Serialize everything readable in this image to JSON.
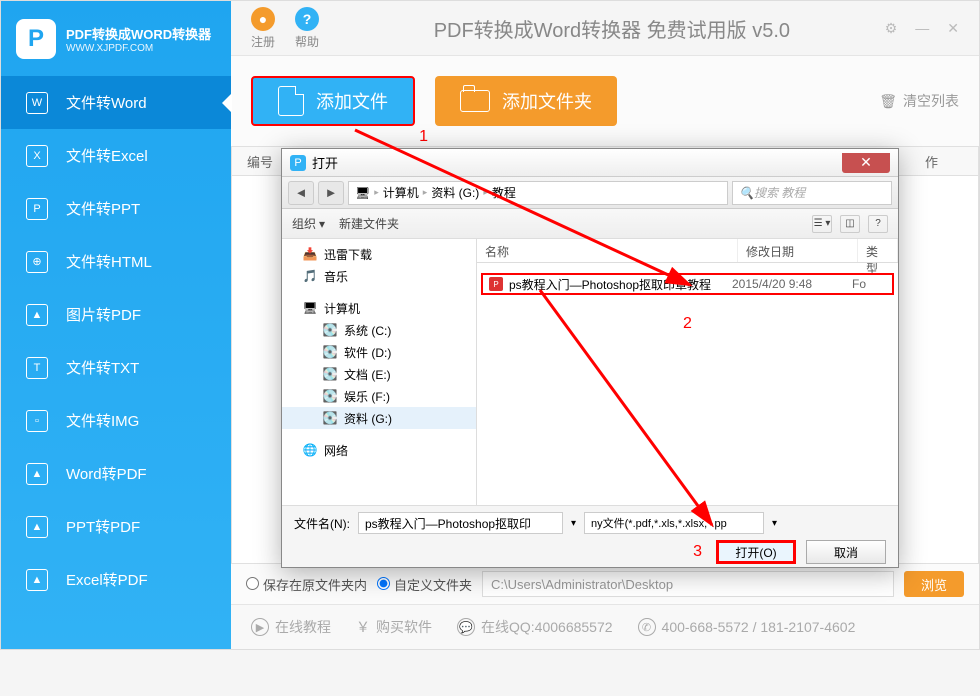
{
  "logo": {
    "title": "PDF转换成WORD转换器",
    "url": "WWW.XJPDF.COM"
  },
  "header": {
    "register": "注册",
    "help": "帮助",
    "title": "PDF转换成Word转换器 免费试用版 v5.0"
  },
  "sidebar": [
    {
      "icon": "W",
      "label": "文件转Word",
      "active": true
    },
    {
      "icon": "X",
      "label": "文件转Excel"
    },
    {
      "icon": "P",
      "label": "文件转PPT"
    },
    {
      "icon": "⊕",
      "label": "文件转HTML"
    },
    {
      "icon": "▲",
      "label": "图片转PDF"
    },
    {
      "icon": "T",
      "label": "文件转TXT"
    },
    {
      "icon": "▫",
      "label": "文件转IMG"
    },
    {
      "icon": "▲",
      "label": "Word转PDF"
    },
    {
      "icon": "▲",
      "label": "PPT转PDF"
    },
    {
      "icon": "▲",
      "label": "Excel转PDF"
    }
  ],
  "toolbar": {
    "add_file": "添加文件",
    "add_folder": "添加文件夹",
    "clear": "清空列表"
  },
  "table": {
    "col_num": "编号",
    "col_action": "作"
  },
  "output": {
    "keep": "保存在原文件夹内",
    "custom": "自定义文件夹",
    "path": "C:\\Users\\Administrator\\Desktop",
    "browse": "浏览"
  },
  "footer": {
    "tutorial": "在线教程",
    "buy": "购买软件",
    "qq": "在线QQ:4006685572",
    "phone": "400-668-5572 / 181-2107-4602"
  },
  "dialog": {
    "title": "打开",
    "crumbs": [
      "计算机",
      "资料 (G:)",
      "教程"
    ],
    "search_placeholder": "搜索 教程",
    "organize": "组织",
    "new_folder": "新建文件夹",
    "tree_favs": [
      "迅雷下载",
      "音乐"
    ],
    "tree_computer": "计算机",
    "tree_drives": [
      "系统 (C:)",
      "软件 (D:)",
      "文档 (E:)",
      "娱乐 (F:)",
      "资料 (G:)"
    ],
    "tree_network": "网络",
    "columns": {
      "name": "名称",
      "date": "修改日期",
      "type": "类型"
    },
    "file": {
      "name": "ps教程入门—Photoshop抠取印章教程",
      "date": "2015/4/20 9:48",
      "type": "Fo"
    },
    "filename_label": "文件名(N):",
    "filename_value": "ps教程入门—Photoshop抠取印",
    "filter": "ny文件(*.pdf,*.xls,*.xlsx,*.pp",
    "open_btn": "打开(O)",
    "cancel_btn": "取消"
  },
  "annotations": {
    "n1": "1",
    "n2": "2",
    "n3": "3"
  }
}
